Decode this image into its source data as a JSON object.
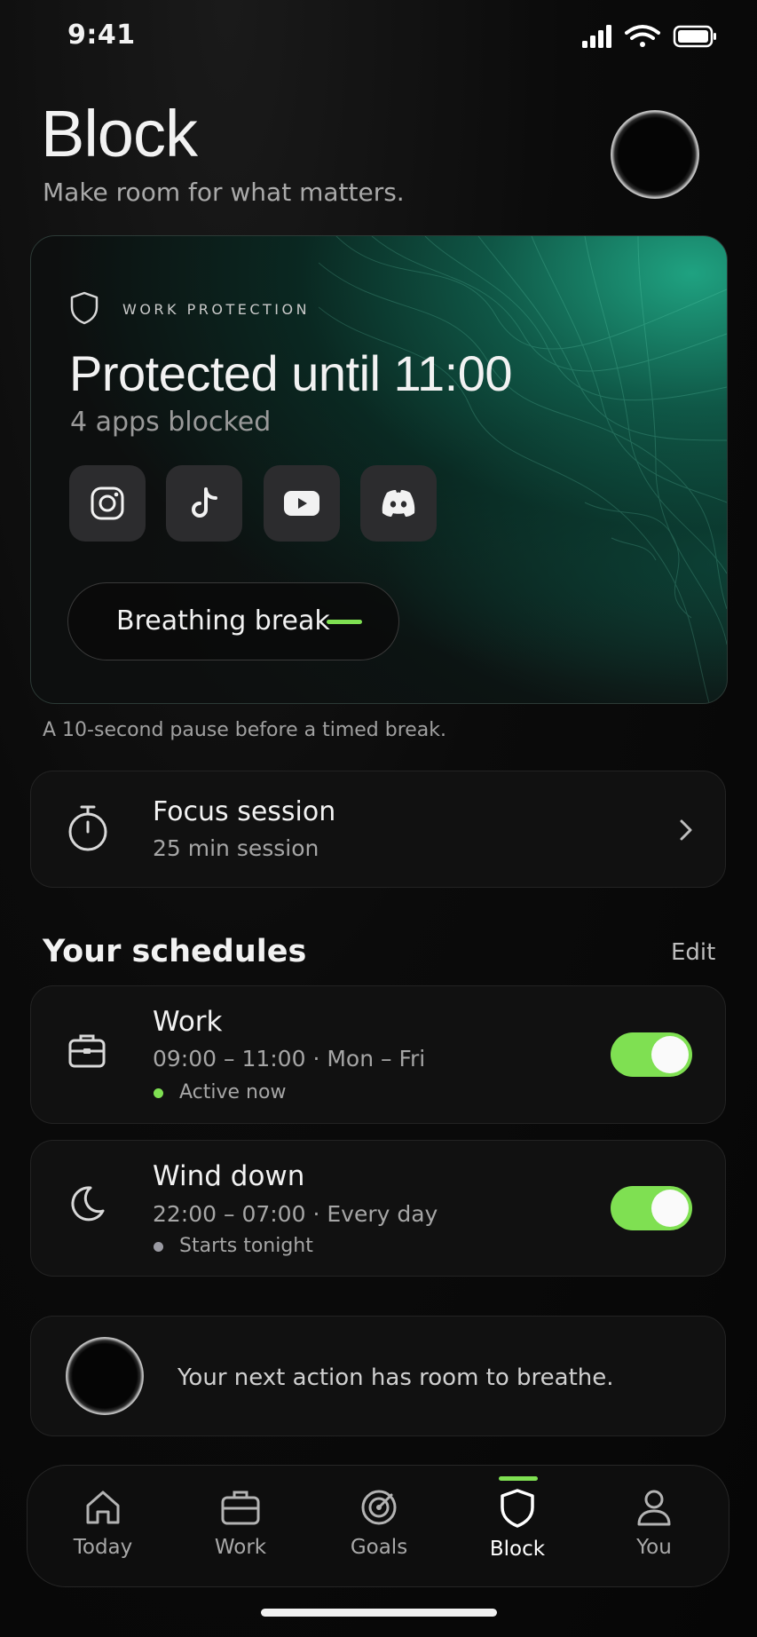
{
  "status_bar": {
    "time": "9:41"
  },
  "header": {
    "title": "Block",
    "subtitle": "Make room for what matters."
  },
  "protection": {
    "eyebrow": "WORK PROTECTION",
    "title": "Protected until 11:00",
    "subtitle": "4 apps blocked",
    "apps": [
      "instagram-icon",
      "tiktok-icon",
      "youtube-icon",
      "discord-icon"
    ],
    "break_button": "Breathing break",
    "caption": "A 10-second pause before a timed break."
  },
  "focus": {
    "title": "Focus session",
    "subtitle": "25 min session"
  },
  "schedules": {
    "title": "Your schedules",
    "edit": "Edit",
    "items": [
      {
        "name": "Work",
        "time": "09:00 – 11:00",
        "sep": "·",
        "days": "Mon – Fri",
        "status": "Active now",
        "enabled": true,
        "dot_color": "#7fe052"
      },
      {
        "name": "Wind down",
        "time": "22:00 – 07:00",
        "sep": "·",
        "days": "Every day",
        "status": "Starts tonight",
        "enabled": true,
        "dot_color": "#9a9aa2"
      }
    ]
  },
  "message": {
    "text": "Your next action has room to breathe."
  },
  "tabs": [
    {
      "label": "Today",
      "icon": "home-icon"
    },
    {
      "label": "Work",
      "icon": "briefcase-icon"
    },
    {
      "label": "Goals",
      "icon": "target-icon"
    },
    {
      "label": "Block",
      "icon": "shield-icon",
      "active": true
    },
    {
      "label": "You",
      "icon": "person-icon"
    }
  ],
  "colors": {
    "accent": "#7fe052",
    "background": "#0b0b0b",
    "card": "#111111"
  }
}
